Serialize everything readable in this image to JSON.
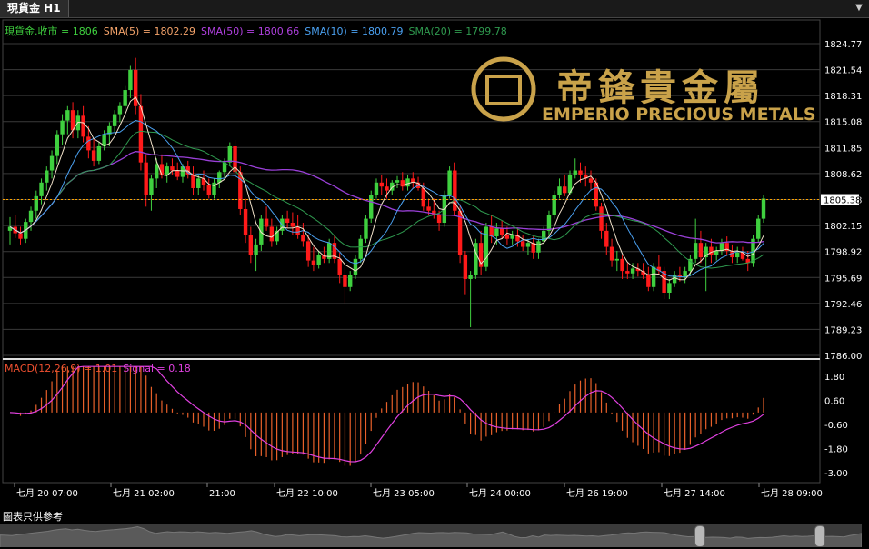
{
  "tab": {
    "title": "現貨金 H1",
    "menu_icon": "chevron-down-icon"
  },
  "legend_main": [
    {
      "text": "現貨金.收市 = 1806",
      "color": "#3fd03f"
    },
    {
      "text": "SMA(5) = 1802.29",
      "color": "#f4a36a"
    },
    {
      "text": "SMA(50) = 1800.66",
      "color": "#b040e0"
    },
    {
      "text": "SMA(10) = 1800.79",
      "color": "#4aa0f0"
    },
    {
      "text": "SMA(20) = 1799.78",
      "color": "#2f9a4f"
    }
  ],
  "legend_macd": [
    {
      "text": "MACD(12,26,9) = 1.01",
      "color": "#f05030"
    },
    {
      "text": "Signal = 0.18",
      "color": "#e040e0"
    }
  ],
  "logo": {
    "cn": "帝鋒貴金屬",
    "en": "EMPERIO PRECIOUS METALS"
  },
  "disclaimer": "圖表只供參考",
  "colors": {
    "up": "#3fd03f",
    "down": "#ff1a1a",
    "macd_bar": "#e8602a",
    "signal": "#e040e0",
    "sma5": "#f0e0c8",
    "sma10": "#4aa0f0",
    "sma20": "#2f9a4f",
    "sma50": "#9a40d8",
    "price_line": "#ffa500"
  },
  "chart_data": [
    {
      "type": "candlestick",
      "title": "現貨金 H1",
      "price_axis_ticks": [
        "1824.77",
        "1821.54",
        "1818.31",
        "1815.08",
        "1811.85",
        "1808.62",
        "1805.38",
        "1802.15",
        "1798.92",
        "1795.69",
        "1792.46",
        "1789.23",
        "1786.00"
      ],
      "ylim": [
        1786.0,
        1824.77
      ],
      "current_price_label": "1805.38",
      "current_price": 1805.38,
      "x_tick_labels": [
        "七月 20 07:00",
        "七月 21 02:00",
        "21:00",
        "七月 22 10:00",
        "七月 23 05:00",
        "七月 24 00:00",
        "七月 26 19:00",
        "七月 27 14:00",
        "七月 28 09:00"
      ],
      "candles": [
        [
          1801.5,
          1803.2,
          1799.8,
          1802.0
        ],
        [
          1802.0,
          1803.5,
          1800.6,
          1801.2
        ],
        [
          1801.2,
          1802.0,
          1799.8,
          1800.5
        ],
        [
          1800.5,
          1803.0,
          1800.0,
          1802.6
        ],
        [
          1802.6,
          1804.5,
          1801.5,
          1804.0
        ],
        [
          1804.0,
          1806.5,
          1803.0,
          1805.8
        ],
        [
          1805.8,
          1808.0,
          1804.8,
          1807.5
        ],
        [
          1807.5,
          1809.5,
          1806.5,
          1809.0
        ],
        [
          1809.0,
          1811.5,
          1808.0,
          1810.8
        ],
        [
          1810.8,
          1814.0,
          1809.8,
          1813.5
        ],
        [
          1813.5,
          1816.0,
          1812.2,
          1815.2
        ],
        [
          1815.2,
          1817.0,
          1813.5,
          1816.5
        ],
        [
          1816.5,
          1817.5,
          1813.0,
          1814.0
        ],
        [
          1814.0,
          1816.5,
          1813.0,
          1815.8
        ],
        [
          1815.8,
          1817.0,
          1812.5,
          1813.2
        ],
        [
          1813.2,
          1814.5,
          1810.5,
          1811.5
        ],
        [
          1811.5,
          1813.0,
          1809.5,
          1810.2
        ],
        [
          1810.2,
          1812.5,
          1809.8,
          1812.0
        ],
        [
          1812.0,
          1814.0,
          1811.5,
          1813.5
        ],
        [
          1813.5,
          1815.0,
          1812.0,
          1814.5
        ],
        [
          1814.5,
          1816.5,
          1813.8,
          1816.0
        ],
        [
          1816.0,
          1817.5,
          1815.0,
          1817.0
        ],
        [
          1817.0,
          1819.5,
          1816.5,
          1819.0
        ],
        [
          1819.0,
          1822.0,
          1818.0,
          1821.5
        ],
        [
          1821.5,
          1823.0,
          1816.0,
          1817.0
        ],
        [
          1817.0,
          1818.5,
          1809.0,
          1810.0
        ],
        [
          1810.0,
          1811.0,
          1804.5,
          1806.0
        ],
        [
          1806.0,
          1808.5,
          1804.0,
          1808.0
        ],
        [
          1808.0,
          1810.5,
          1806.8,
          1809.8
        ],
        [
          1809.8,
          1811.0,
          1808.0,
          1808.5
        ],
        [
          1808.5,
          1810.0,
          1807.5,
          1809.5
        ],
        [
          1809.5,
          1810.5,
          1808.5,
          1809.0
        ],
        [
          1809.0,
          1810.0,
          1807.8,
          1808.2
        ],
        [
          1808.2,
          1809.8,
          1807.5,
          1809.5
        ],
        [
          1809.5,
          1810.2,
          1808.0,
          1808.5
        ],
        [
          1808.5,
          1809.5,
          1806.0,
          1806.8
        ],
        [
          1806.8,
          1808.5,
          1806.0,
          1808.0
        ],
        [
          1808.0,
          1809.0,
          1806.5,
          1807.2
        ],
        [
          1807.2,
          1808.0,
          1805.5,
          1806.0
        ],
        [
          1806.0,
          1808.0,
          1805.5,
          1807.5
        ],
        [
          1807.5,
          1809.0,
          1806.8,
          1808.8
        ],
        [
          1808.8,
          1810.5,
          1808.0,
          1810.0
        ],
        [
          1810.0,
          1812.5,
          1809.5,
          1812.0
        ],
        [
          1812.0,
          1812.8,
          1808.0,
          1808.8
        ],
        [
          1808.8,
          1809.5,
          1803.5,
          1804.2
        ],
        [
          1804.2,
          1805.5,
          1800.0,
          1801.0
        ],
        [
          1801.0,
          1802.0,
          1797.5,
          1798.5
        ],
        [
          1798.5,
          1800.5,
          1796.5,
          1799.8
        ],
        [
          1799.8,
          1803.5,
          1799.0,
          1803.0
        ],
        [
          1803.0,
          1804.5,
          1801.5,
          1802.0
        ],
        [
          1802.0,
          1803.0,
          1799.5,
          1800.2
        ],
        [
          1800.2,
          1802.0,
          1799.8,
          1801.5
        ],
        [
          1801.5,
          1803.5,
          1801.0,
          1803.0
        ],
        [
          1803.0,
          1804.0,
          1801.8,
          1802.5
        ],
        [
          1802.5,
          1803.8,
          1801.0,
          1802.0
        ],
        [
          1802.0,
          1803.5,
          1800.5,
          1801.0
        ],
        [
          1801.0,
          1802.5,
          1799.5,
          1800.2
        ],
        [
          1800.2,
          1801.0,
          1797.0,
          1797.8
        ],
        [
          1797.8,
          1799.5,
          1796.5,
          1797.2
        ],
        [
          1797.2,
          1799.0,
          1796.8,
          1798.5
        ],
        [
          1798.5,
          1799.5,
          1797.5,
          1798.0
        ],
        [
          1798.0,
          1800.5,
          1797.5,
          1800.0
        ],
        [
          1800.0,
          1801.0,
          1797.5,
          1798.0
        ],
        [
          1798.0,
          1798.8,
          1795.0,
          1796.0
        ],
        [
          1796.0,
          1797.0,
          1792.5,
          1794.5
        ],
        [
          1794.5,
          1796.5,
          1794.0,
          1796.0
        ],
        [
          1796.0,
          1798.5,
          1795.5,
          1798.0
        ],
        [
          1798.0,
          1801.0,
          1797.5,
          1800.5
        ],
        [
          1800.5,
          1803.5,
          1800.0,
          1803.0
        ],
        [
          1803.0,
          1806.5,
          1802.5,
          1806.0
        ],
        [
          1806.0,
          1808.0,
          1805.5,
          1807.5
        ],
        [
          1807.5,
          1808.5,
          1806.0,
          1807.0
        ],
        [
          1807.0,
          1808.0,
          1805.5,
          1806.5
        ],
        [
          1806.5,
          1807.8,
          1806.0,
          1807.5
        ],
        [
          1807.5,
          1808.3,
          1806.8,
          1807.8
        ],
        [
          1807.8,
          1808.8,
          1806.5,
          1807.0
        ],
        [
          1807.0,
          1808.5,
          1806.5,
          1808.0
        ],
        [
          1808.0,
          1808.8,
          1806.8,
          1807.5
        ],
        [
          1807.5,
          1808.2,
          1806.5,
          1806.8
        ],
        [
          1806.8,
          1807.5,
          1804.0,
          1804.5
        ],
        [
          1804.5,
          1805.5,
          1803.5,
          1804.0
        ],
        [
          1804.0,
          1805.5,
          1803.0,
          1803.5
        ],
        [
          1803.5,
          1804.0,
          1801.5,
          1802.5
        ],
        [
          1802.5,
          1806.5,
          1802.0,
          1806.0
        ],
        [
          1806.0,
          1809.5,
          1805.5,
          1809.0
        ],
        [
          1809.0,
          1810.0,
          1803.5,
          1804.0
        ],
        [
          1804.0,
          1804.8,
          1797.5,
          1798.5
        ],
        [
          1798.5,
          1799.0,
          1793.5,
          1795.5
        ],
        [
          1795.5,
          1796.5,
          1789.5,
          1796.0
        ],
        [
          1796.0,
          1800.5,
          1795.5,
          1800.0
        ],
        [
          1800.0,
          1801.5,
          1796.0,
          1797.0
        ],
        [
          1797.0,
          1802.5,
          1796.5,
          1802.0
        ],
        [
          1802.0,
          1803.5,
          1800.0,
          1800.8
        ],
        [
          1800.8,
          1802.5,
          1799.8,
          1801.8
        ],
        [
          1801.8,
          1802.8,
          1800.5,
          1801.0
        ],
        [
          1801.0,
          1802.0,
          1799.8,
          1800.5
        ],
        [
          1800.5,
          1801.5,
          1799.8,
          1801.0
        ],
        [
          1801.0,
          1801.8,
          1799.5,
          1800.2
        ],
        [
          1800.2,
          1801.0,
          1799.0,
          1799.5
        ],
        [
          1799.5,
          1800.5,
          1798.5,
          1800.0
        ],
        [
          1800.0,
          1800.8,
          1798.0,
          1798.8
        ],
        [
          1798.8,
          1800.5,
          1798.0,
          1800.2
        ],
        [
          1800.2,
          1802.0,
          1799.8,
          1801.5
        ],
        [
          1801.5,
          1804.0,
          1801.0,
          1803.5
        ],
        [
          1803.5,
          1806.5,
          1803.0,
          1806.0
        ],
        [
          1806.0,
          1808.0,
          1805.5,
          1807.0
        ],
        [
          1807.0,
          1808.5,
          1805.8,
          1806.2
        ],
        [
          1806.2,
          1809.0,
          1806.0,
          1808.5
        ],
        [
          1808.5,
          1810.5,
          1808.0,
          1809.0
        ],
        [
          1809.0,
          1810.0,
          1807.5,
          1808.5
        ],
        [
          1808.5,
          1809.5,
          1807.0,
          1808.0
        ],
        [
          1808.0,
          1809.0,
          1806.5,
          1807.5
        ],
        [
          1807.5,
          1808.0,
          1804.0,
          1804.5
        ],
        [
          1804.5,
          1805.0,
          1800.5,
          1801.5
        ],
        [
          1801.5,
          1802.5,
          1798.5,
          1799.5
        ],
        [
          1799.5,
          1800.5,
          1797.0,
          1797.8
        ],
        [
          1797.8,
          1799.0,
          1796.5,
          1798.0
        ],
        [
          1798.0,
          1798.5,
          1795.5,
          1796.5
        ],
        [
          1796.5,
          1797.5,
          1795.5,
          1796.2
        ],
        [
          1796.2,
          1797.5,
          1795.5,
          1796.8
        ],
        [
          1796.8,
          1797.5,
          1795.8,
          1796.5
        ],
        [
          1796.5,
          1797.5,
          1795.5,
          1796.0
        ],
        [
          1796.0,
          1797.0,
          1794.0,
          1794.5
        ],
        [
          1794.5,
          1797.5,
          1794.0,
          1797.0
        ],
        [
          1797.0,
          1798.5,
          1796.0,
          1796.5
        ],
        [
          1796.5,
          1797.0,
          1793.0,
          1793.8
        ],
        [
          1793.8,
          1795.5,
          1793.0,
          1795.0
        ],
        [
          1795.0,
          1796.5,
          1794.5,
          1796.0
        ],
        [
          1796.0,
          1797.0,
          1795.2,
          1795.8
        ],
        [
          1795.8,
          1797.0,
          1795.0,
          1796.5
        ],
        [
          1796.5,
          1798.5,
          1796.0,
          1798.0
        ],
        [
          1798.0,
          1803.0,
          1797.5,
          1800.0
        ],
        [
          1800.0,
          1801.5,
          1797.5,
          1798.2
        ],
        [
          1798.2,
          1800.0,
          1794.0,
          1799.5
        ],
        [
          1799.5,
          1800.5,
          1797.5,
          1798.5
        ],
        [
          1798.5,
          1799.5,
          1797.8,
          1799.0
        ],
        [
          1799.0,
          1800.5,
          1798.5,
          1800.0
        ],
        [
          1800.0,
          1800.8,
          1798.5,
          1799.0
        ],
        [
          1799.0,
          1799.8,
          1797.5,
          1798.2
        ],
        [
          1798.2,
          1799.5,
          1797.5,
          1798.8
        ],
        [
          1798.8,
          1799.5,
          1797.8,
          1798.0
        ],
        [
          1798.0,
          1799.0,
          1796.5,
          1797.5
        ],
        [
          1797.5,
          1801.0,
          1797.0,
          1800.5
        ],
        [
          1800.5,
          1803.5,
          1800.0,
          1803.0
        ],
        [
          1803.0,
          1806.0,
          1802.5,
          1805.5
        ]
      ],
      "current_close": 1806,
      "sma5_last": 1802.29,
      "sma10_last": 1800.79,
      "sma20_last": 1799.78,
      "sma50_last": 1800.66
    },
    {
      "type": "bar",
      "title": "MACD(12,26,9)",
      "macd_last": 1.01,
      "signal_last": 0.18,
      "axis_ticks": [
        "1.80",
        "0.60",
        "-0.60",
        "-1.80",
        "-3.00"
      ],
      "ylim": [
        -3.5,
        2.4
      ]
    }
  ]
}
